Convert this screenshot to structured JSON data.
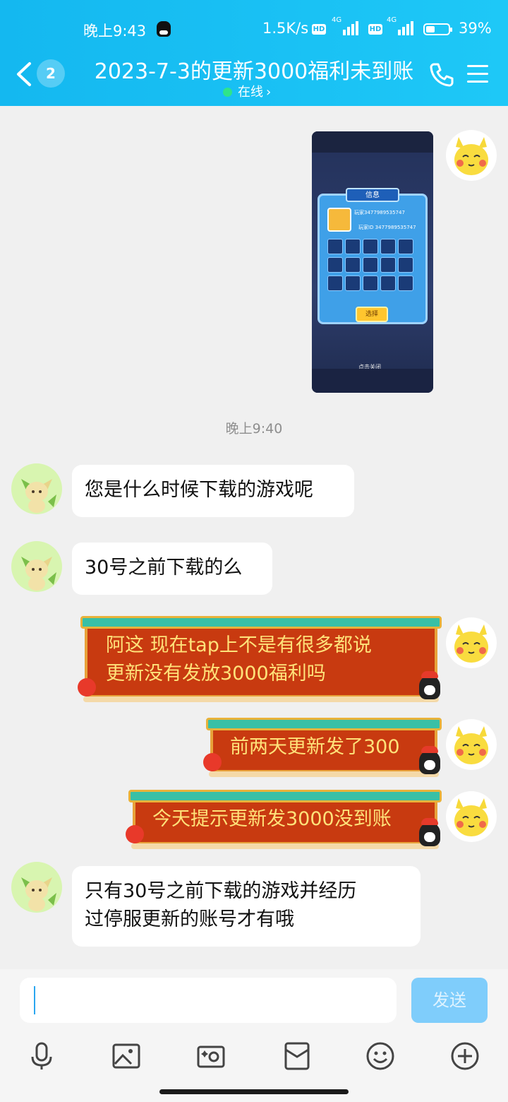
{
  "status_bar": {
    "time": "晚上9:43",
    "net_speed": "1.5K/s",
    "hd1": "HD",
    "net1": "4G",
    "hd2": "HD",
    "net2": "4G",
    "battery_pct": "39%"
  },
  "header": {
    "unread_badge": "2",
    "title": "2023-7-3的更新3000福利未到账",
    "presence": "在线",
    "presence_arrow": "›"
  },
  "game_screenshot": {
    "panel_title": "信息",
    "player_name": "玩家3477989535747",
    "player_id": "玩家ID  3477989535747",
    "select_button": "选择",
    "close_hint": "点击关闭"
  },
  "timestamp": "晚上9:40",
  "messages": [
    {
      "side": "left",
      "text": "您是什么时候下载的游戏呢"
    },
    {
      "side": "left",
      "text": "30号之前下载的么"
    },
    {
      "side": "right",
      "line1": "阿这 现在tap上不是有很多都说",
      "line2": "更新没有发放3000福利吗"
    },
    {
      "side": "right",
      "text": "前两天更新发了300"
    },
    {
      "side": "right",
      "text": "今天提示更新发3000没到账"
    },
    {
      "side": "left",
      "line1": "只有30号之前下载的游戏并经历",
      "line2": "过停服更新的账号才有哦"
    }
  ],
  "composer": {
    "input_value": "",
    "send_label": "发送"
  },
  "toolbar_icons": [
    "microphone-icon",
    "image-icon",
    "camera-icon",
    "red-packet-icon",
    "emoji-icon",
    "plus-icon"
  ],
  "colors": {
    "header": "#1ec8f7",
    "send_button": "#7fcdfb",
    "fancy_bubble": "#c83a10",
    "fancy_text": "#ffe27a"
  }
}
